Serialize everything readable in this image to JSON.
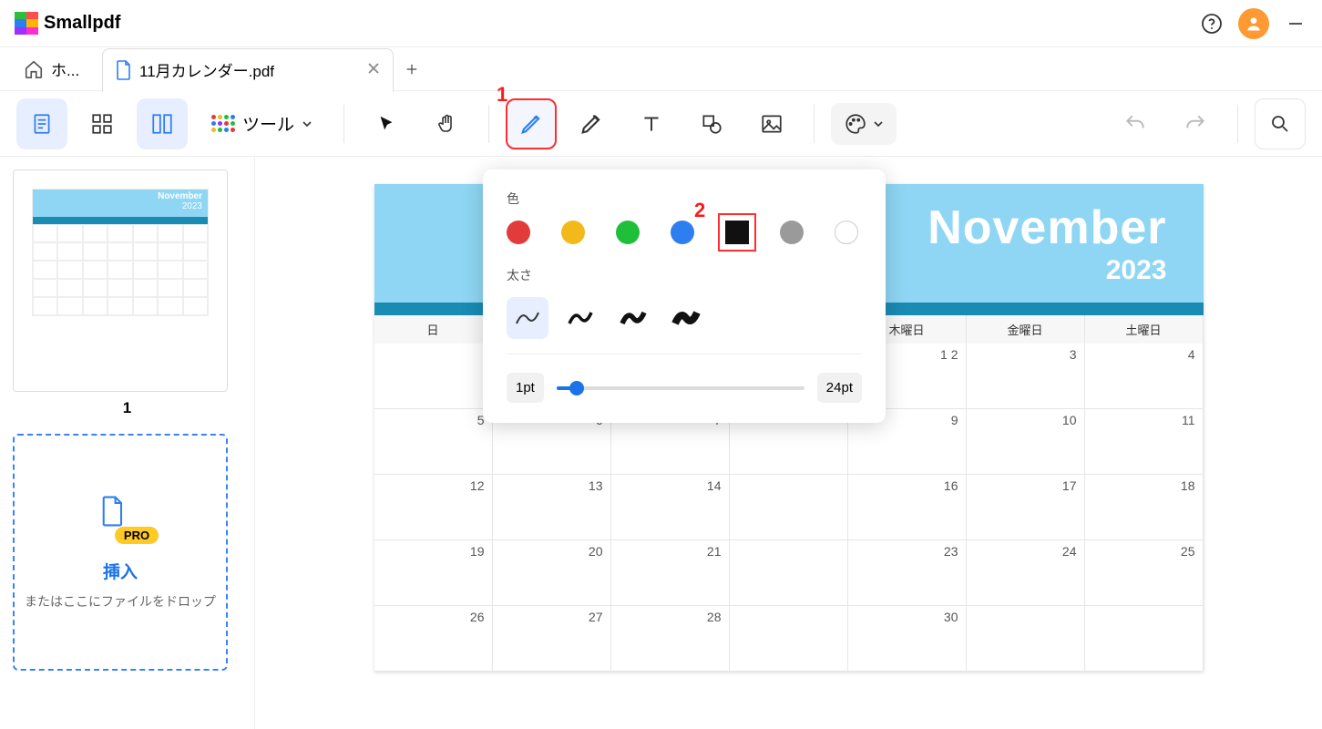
{
  "app": {
    "brand": "Smallpdf"
  },
  "tabs": {
    "home_label": "ホ...",
    "active_label": "11月カレンダー.pdf"
  },
  "toolbar": {
    "tools_label": "ツール"
  },
  "sidebar": {
    "thumb_title": "November",
    "thumb_year": "2023",
    "thumb_number": "1",
    "dropzone": {
      "pro": "PRO",
      "title": "挿入",
      "subtitle": "またはここにファイルをドロップ"
    }
  },
  "document": {
    "title": "November",
    "year": "2023",
    "day_headers": [
      "日",
      "",
      "",
      "",
      "木曜日",
      "金曜日",
      "土曜日"
    ],
    "dates": [
      [
        "",
        "",
        "",
        "",
        "2",
        "3",
        "4"
      ],
      [
        "5",
        "6",
        "7",
        "",
        "9",
        "10",
        "11"
      ],
      [
        "12",
        "13",
        "14",
        "",
        "16",
        "17",
        "18"
      ],
      [
        "19",
        "20",
        "21",
        "",
        "23",
        "24",
        "25"
      ],
      [
        "26",
        "27",
        "28",
        "",
        "30",
        "",
        ""
      ]
    ],
    "first_row_right": [
      "1",
      "",
      "",
      ""
    ]
  },
  "popup": {
    "color_label": "色",
    "thickness_label": "太さ",
    "min_pt": "1pt",
    "max_pt": "24pt",
    "colors": [
      "#e23b3b",
      "#f3b91a",
      "#1fbf3a",
      "#2d7ef0",
      "#111111",
      "#9a9a9a",
      "#ffffff"
    ],
    "selected_color_index": 4,
    "selected_thickness_index": 0
  },
  "annotations": {
    "one": "1",
    "two": "2"
  }
}
